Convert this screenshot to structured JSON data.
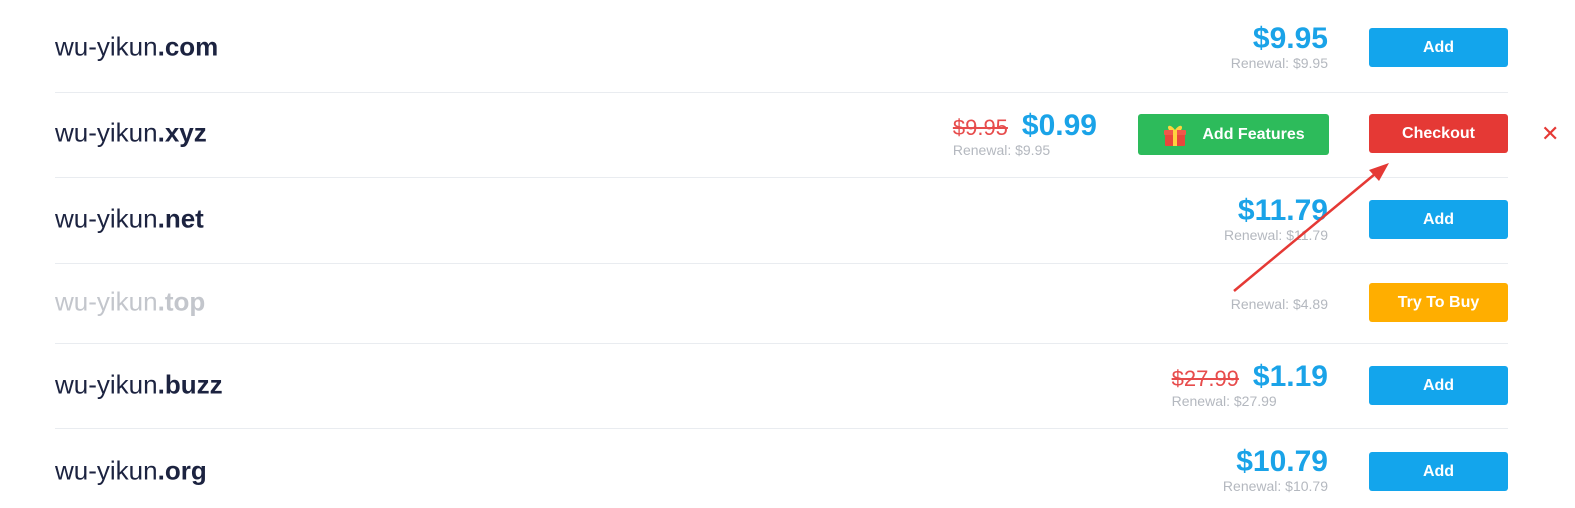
{
  "domains": [
    {
      "name": "wu-yikun",
      "tld": ".com",
      "old_price": "",
      "price": "$9.95",
      "renewal": "Renewal: $9.95",
      "action": "Add"
    },
    {
      "name": "wu-yikun",
      "tld": ".xyz",
      "old_price": "$9.95",
      "price": "$0.99",
      "renewal": "Renewal: $9.95",
      "features_label": "Add Features",
      "action": "Checkout",
      "remove_icon": "✕"
    },
    {
      "name": "wu-yikun",
      "tld": ".net",
      "old_price": "",
      "price": "$11.79",
      "renewal": "Renewal: $11.79",
      "action": "Add"
    },
    {
      "name": "wu-yikun",
      "tld": ".top",
      "old_price": "",
      "price": "",
      "renewal": "Renewal: $4.89",
      "action": "Try To Buy"
    },
    {
      "name": "wu-yikun",
      "tld": ".buzz",
      "old_price": "$27.99",
      "price": "$1.19",
      "renewal": "Renewal: $27.99",
      "action": "Add"
    },
    {
      "name": "wu-yikun",
      "tld": ".org",
      "old_price": "",
      "price": "$10.79",
      "renewal": "Renewal: $10.79",
      "action": "Add"
    }
  ],
  "icons": {
    "gift": "gift-icon",
    "remove": "close-icon",
    "annotation": "red-arrow"
  },
  "colors": {
    "primary_blue": "#13a5ec",
    "price_blue": "#1aa3e8",
    "checkout_red": "#e53935",
    "features_green": "#2dbb5b",
    "try_orange": "#ffae00",
    "old_price_red": "#e74c4c"
  }
}
